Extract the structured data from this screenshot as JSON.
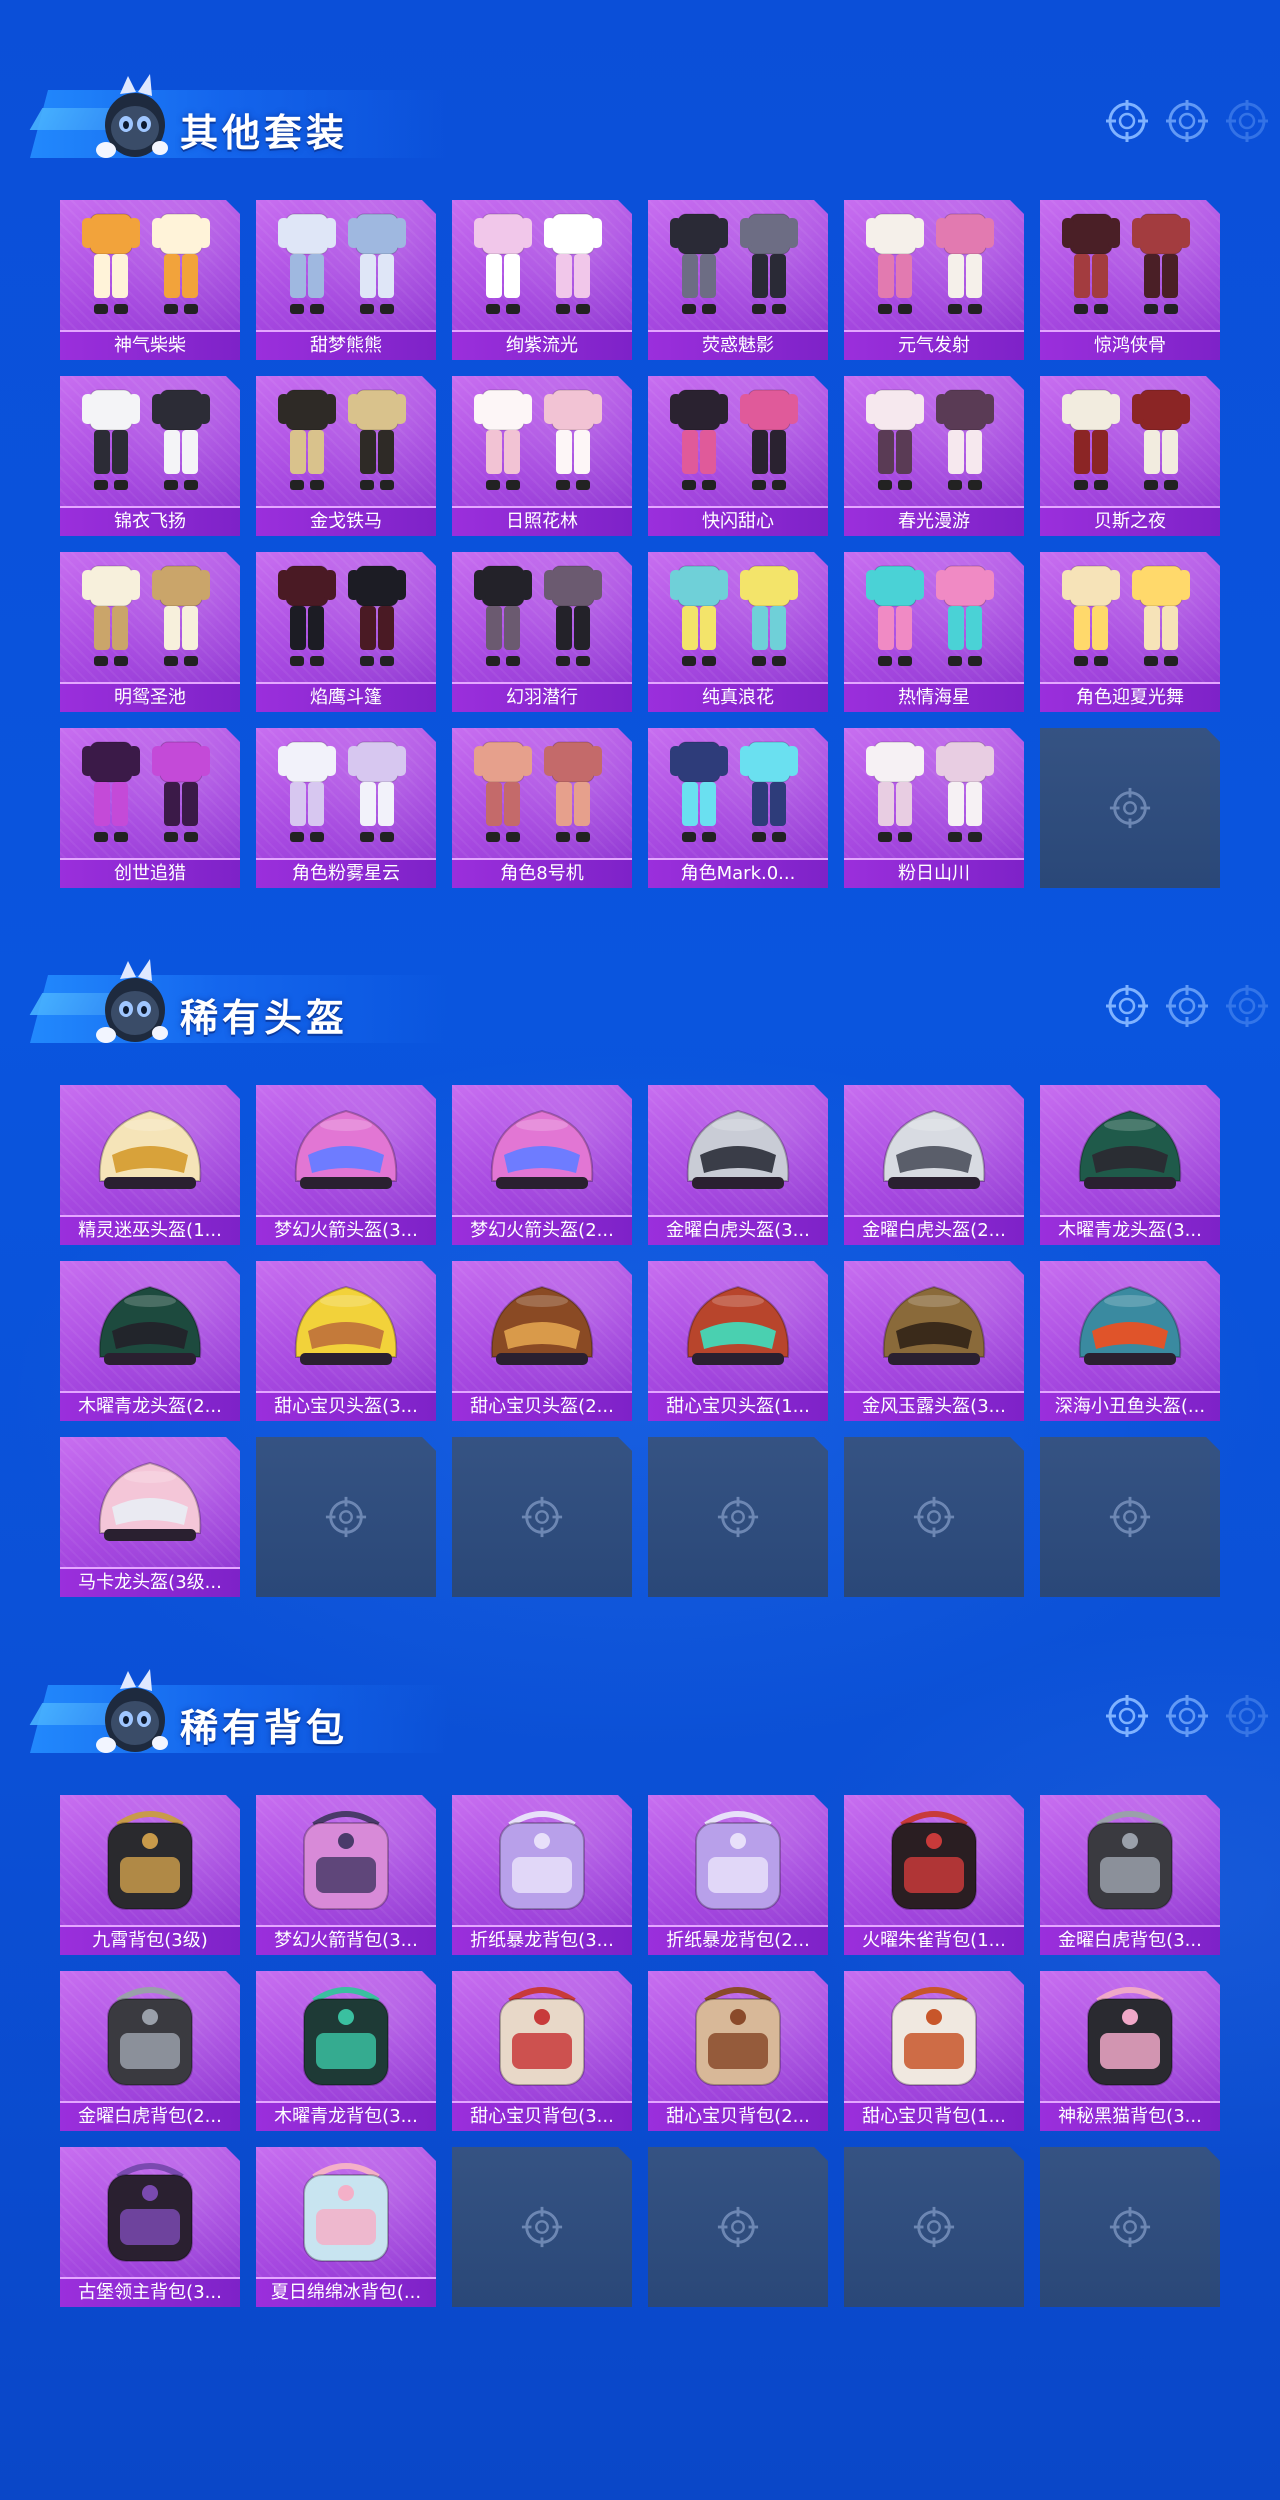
{
  "colors": {
    "background": "#0b4fd8",
    "card_purple": "#a648e0",
    "label_bar": "#8a28d0",
    "empty_slot": "#2d4a78",
    "title_text": "#ffffff"
  },
  "sections": [
    {
      "title": "其他套装",
      "item_type": "outfit",
      "items": [
        "神气柴柴",
        "甜梦熊熊",
        "绚紫流光",
        "荧惑魅影",
        "元气发射",
        "惊鸿侠骨",
        "锦衣飞扬",
        "金戈铁马",
        "日照花林",
        "快闪甜心",
        "春光漫游",
        "贝斯之夜",
        "明鸳圣池",
        "焰鹰斗篷",
        "幻羽潜行",
        "纯真浪花",
        "热情海星",
        "角色迎夏光舞",
        "创世追猎",
        "角色粉雾星云",
        "角色8号机",
        "角色Mark.0...",
        "粉日山川"
      ],
      "empty_slots": 1
    },
    {
      "title": "稀有头盔",
      "item_type": "helmet",
      "items": [
        "精灵迷巫头盔(1...",
        "梦幻火箭头盔(3...",
        "梦幻火箭头盔(2...",
        "金曜白虎头盔(3...",
        "金曜白虎头盔(2...",
        "木曜青龙头盔(3...",
        "木曜青龙头盔(2...",
        "甜心宝贝头盔(3...",
        "甜心宝贝头盔(2...",
        "甜心宝贝头盔(1...",
        "金风玉露头盔(3...",
        "深海小丑鱼头盔(...",
        "马卡龙头盔(3级..."
      ],
      "empty_slots": 5
    },
    {
      "title": "稀有背包",
      "item_type": "backpack",
      "items": [
        "九霄背包(3级)",
        "梦幻火箭背包(3...",
        "折纸暴龙背包(3...",
        "折纸暴龙背包(2...",
        "火曜朱雀背包(1...",
        "金曜白虎背包(3...",
        "金曜白虎背包(2...",
        "木曜青龙背包(3...",
        "甜心宝贝背包(3...",
        "甜心宝贝背包(2...",
        "甜心宝贝背包(1...",
        "神秘黑猫背包(3...",
        "古堡领主背包(3...",
        "夏日绵绵冰背包(..."
      ],
      "empty_slots": 4
    }
  ]
}
